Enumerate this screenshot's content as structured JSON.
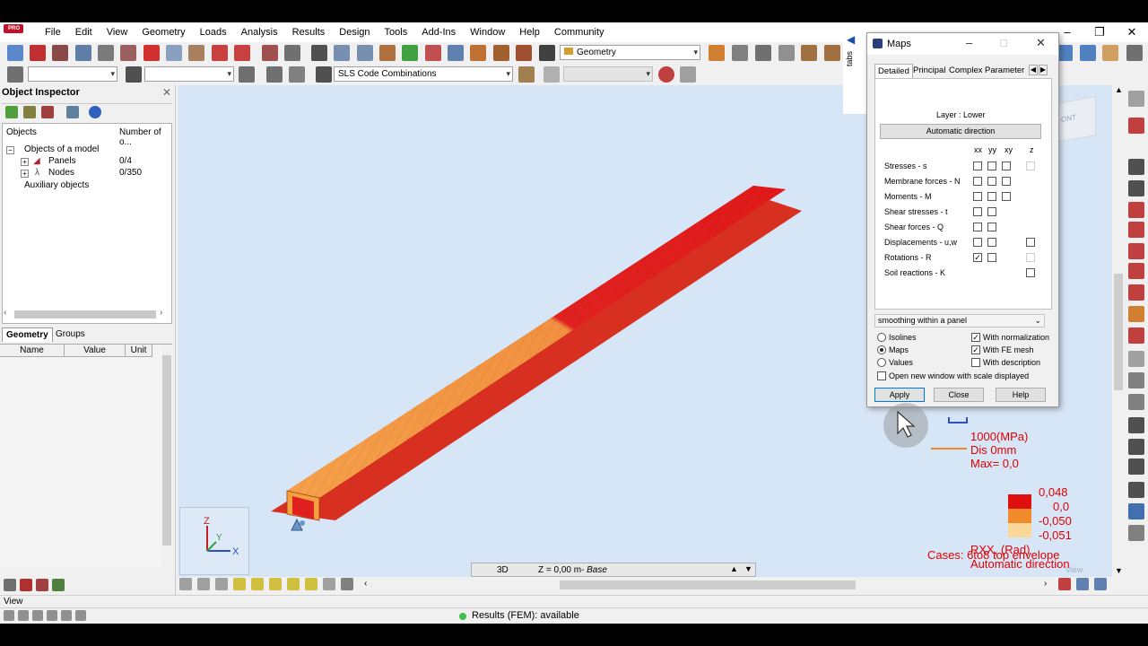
{
  "menu": [
    "File",
    "Edit",
    "View",
    "Geometry",
    "Loads",
    "Analysis",
    "Results",
    "Design",
    "Tools",
    "Add-Ins",
    "Window",
    "Help",
    "Community"
  ],
  "toolbar": {
    "geometry_dropdown": "Geometry",
    "combo_dropdown": "SLS Code Combinations"
  },
  "side_tab_label": "tabs",
  "inspector": {
    "title": "Object Inspector",
    "col_objects": "Objects",
    "col_number": "Number of o...",
    "root": "Objects of a model",
    "rows": [
      {
        "label": "Panels",
        "count": "0/4"
      },
      {
        "label": "Nodes",
        "count": "0/350"
      }
    ],
    "aux": "Auxiliary objects",
    "tab_geometry": "Geometry",
    "tab_groups": "Groups",
    "prop_name": "Name",
    "prop_value": "Value",
    "prop_unit": "Unit"
  },
  "maps": {
    "title": "Maps",
    "tabs": [
      "Detailed",
      "Principal",
      "Complex",
      "Parameter"
    ],
    "layer": "Layer : Lower",
    "auto_direction": "Automatic direction",
    "col_headers": [
      "xx",
      "yy",
      "xy",
      "z"
    ],
    "rows": [
      {
        "label": "Stresses - s"
      },
      {
        "label": "Membrane forces - N"
      },
      {
        "label": "Moments - M"
      },
      {
        "label": "Shear stresses - t"
      },
      {
        "label": "Shear forces - Q"
      },
      {
        "label": "Displacements - u,w"
      },
      {
        "label": "Rotations - R"
      },
      {
        "label": "Soil reactions - K"
      }
    ],
    "smoothing": "smoothing within a panel",
    "opt_isolines": "Isolines",
    "opt_maps": "Maps",
    "opt_values": "Values",
    "opt_normalization": "With normalization",
    "opt_fe_mesh": "With FE mesh",
    "opt_description": "With description",
    "opt_new_window": "Open new window with scale displayed",
    "btn_apply": "Apply",
    "btn_close": "Close",
    "btn_help": "Help",
    "selected_mode": "Maps"
  },
  "legend": {
    "scale_value": "1000(MPa)",
    "dis": "Dis   0mm",
    "max": "Max=    0,0",
    "values": [
      "0,048",
      "0,0",
      "-0,050",
      "-0,051"
    ],
    "colors": [
      "#e01010",
      "#e01010",
      "#f08a2a",
      "#fbd79a"
    ],
    "title": "RXX, (Rad)",
    "direction": "Automatic direction",
    "cases": "Cases: 6to8  top envelope"
  },
  "viewport": {
    "mode": "3D",
    "level": "Z = 0,00 m",
    "level_suffix": " - Base",
    "corner_label": "View"
  },
  "status": {
    "view": "View",
    "fem": "Results (FEM): available"
  }
}
